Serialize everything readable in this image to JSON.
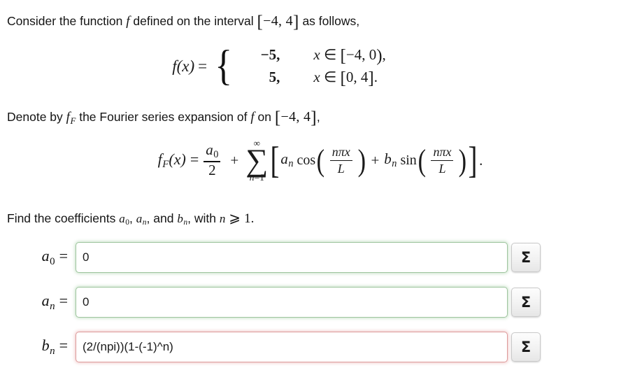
{
  "problem": {
    "intro": {
      "before_f": "Consider the function",
      "f_symbol": "f",
      "after_f": "defined on the interval",
      "interval_open": "[",
      "interval_text": "−4, 4",
      "interval_close": "]",
      "tail": "as follows,"
    },
    "piecewise": {
      "lhs": "f(x)",
      "equals": "=",
      "brace": "{",
      "rows": [
        {
          "value": "−5,",
          "condition_var": "x",
          "condition_in": "∈",
          "bracket_open": "[",
          "domain": "−4, 0",
          "bracket_close": ")",
          "trailing": ","
        },
        {
          "value": "5,",
          "condition_var": "x",
          "condition_in": "∈",
          "bracket_open": "[",
          "domain": "0, 4",
          "bracket_close": "]",
          "trailing": "."
        }
      ]
    },
    "denote": {
      "before": "Denote by",
      "fF_base": "f",
      "fF_sub": "F",
      "middle": "the Fourier series expansion of",
      "f_symbol": "f",
      "on": "on",
      "interval_open": "[",
      "interval_text": "−4, 4",
      "interval_close": "]",
      "tail": ","
    },
    "fourier_formula": {
      "lhs_base": "f",
      "lhs_sub": "F",
      "lhs_arg": "(x)",
      "equals": "=",
      "a0_num": "a",
      "a0_num_sub": "0",
      "a0_den": "2",
      "plus1": "+",
      "sum_upper": "∞",
      "sum_sigma": "∑",
      "sum_lower_var": "n",
      "sum_lower_eq": "=1",
      "bracket_open": "[",
      "an": "a",
      "an_sub": "n",
      "cos": "cos",
      "paren_open": "(",
      "arg_num": "nπx",
      "arg_den": "L",
      "paren_close": ")",
      "plus2": "+",
      "bn": "b",
      "bn_sub": "n",
      "sin": "sin",
      "bracket_close": "]",
      "period": "."
    },
    "find_instruction": {
      "before": "Find the coefficients",
      "coef1_base": "a",
      "coef1_sub": "0",
      "sep1": ",",
      "coef2_base": "a",
      "coef2_sub": "n",
      "sep2": ", and",
      "coef3_base": "b",
      "coef3_sub": "n",
      "sep3": ", with",
      "nvar": "n",
      "ge": "⩾",
      "one": "1."
    }
  },
  "answers": [
    {
      "label_base": "a",
      "label_sub": "0",
      "equals": "=",
      "value": "0",
      "placeholder": "",
      "status": "correct",
      "button_label": "Σ",
      "button_name": "sigma-button-a0"
    },
    {
      "label_base": "a",
      "label_sub": "n",
      "equals": "=",
      "value": "0",
      "placeholder": "",
      "status": "correct",
      "button_label": "Σ",
      "button_name": "sigma-button-an"
    },
    {
      "label_base": "b",
      "label_sub": "n",
      "equals": "=",
      "value": "(2/(npi))(1-(-1)^n)",
      "placeholder": "",
      "status": "incorrect",
      "button_label": "Σ",
      "button_name": "sigma-button-bn"
    }
  ],
  "colors": {
    "correct_border": "#9ec49e",
    "incorrect_border": "#dd9a9a",
    "text": "#141414",
    "background": "#ffffff"
  }
}
